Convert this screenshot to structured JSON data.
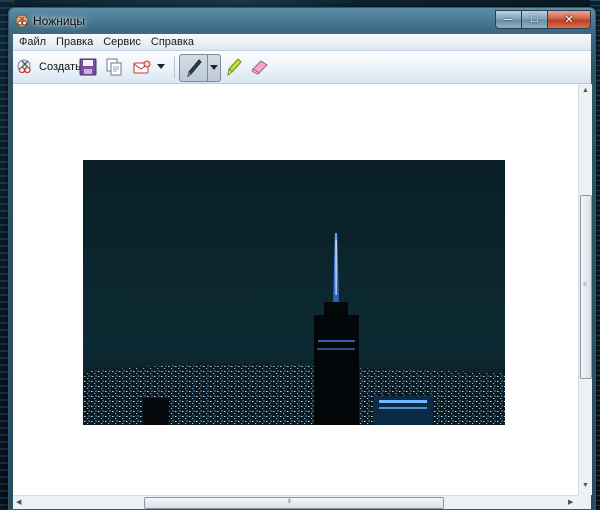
{
  "window": {
    "title": "Ножницы"
  },
  "caption_buttons": {
    "minimize": "—",
    "maximize": "☐",
    "close": "✕"
  },
  "menu": [
    "Файл",
    "Правка",
    "Сервис",
    "Справка"
  ],
  "toolbar": {
    "create_label": "Создать",
    "icons": [
      "new-snip-icon",
      "save-icon",
      "copy-icon",
      "send-email-icon",
      "dropdown-arrow-icon",
      "pen-icon",
      "highlighter-icon",
      "eraser-icon"
    ]
  },
  "colors": {
    "window_frame": "#3d6a83",
    "menu_bar": "#dde8f3",
    "canvas": "#ffffff",
    "close_button": "#cf5a40"
  },
  "scrollbars": {
    "vertical": true,
    "horizontal": true
  }
}
